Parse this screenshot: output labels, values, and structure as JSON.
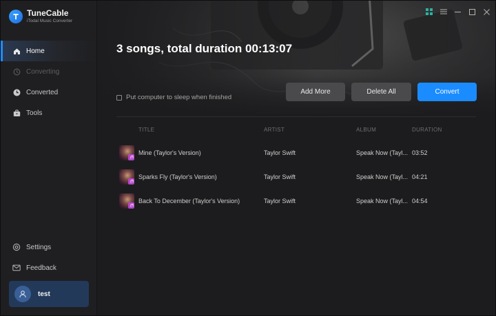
{
  "app": {
    "name": "TuneCable",
    "subtitle": "iTodal Music Converter"
  },
  "sidebar": {
    "items": [
      {
        "label": "Home",
        "icon": "home-icon",
        "state": "active"
      },
      {
        "label": "Converting",
        "icon": "converting-icon",
        "state": "disabled"
      },
      {
        "label": "Converted",
        "icon": "clock-icon",
        "state": "normal"
      },
      {
        "label": "Tools",
        "icon": "toolbox-icon",
        "state": "normal"
      }
    ],
    "bottom_items": [
      {
        "label": "Settings",
        "icon": "gear-icon"
      },
      {
        "label": "Feedback",
        "icon": "mail-icon"
      }
    ],
    "user": {
      "name": "test",
      "icon": "user-icon"
    }
  },
  "window_controls": [
    "grid-icon",
    "menu-icon",
    "minimize-icon",
    "maximize-icon",
    "close-icon"
  ],
  "main": {
    "summary": "3 songs, total duration 00:13:07",
    "sleep_option": {
      "label": "Put computer to sleep when finished",
      "checked": false
    },
    "buttons": {
      "add_more": "Add More",
      "delete_all": "Delete All",
      "convert": "Convert"
    }
  },
  "table": {
    "columns": [
      "TITLE",
      "ARTIST",
      "ALBUM",
      "DURATION"
    ],
    "rows": [
      {
        "title": "Mine (Taylor's Version)",
        "artist": "Taylor Swift",
        "album": "Speak Now (Tayl...",
        "duration": "03:52"
      },
      {
        "title": "Sparks Fly (Taylor's Version)",
        "artist": "Taylor Swift",
        "album": "Speak Now (Tayl...",
        "duration": "04:21"
      },
      {
        "title": "Back To December (Taylor's Version)",
        "artist": "Taylor Swift",
        "album": "Speak Now (Tayl...",
        "duration": "04:54"
      }
    ]
  },
  "colors": {
    "accent": "#1a8cff",
    "sidebar_bg": "#1f1f22",
    "main_bg": "#1c1c1e",
    "user_card": "#22395a"
  }
}
